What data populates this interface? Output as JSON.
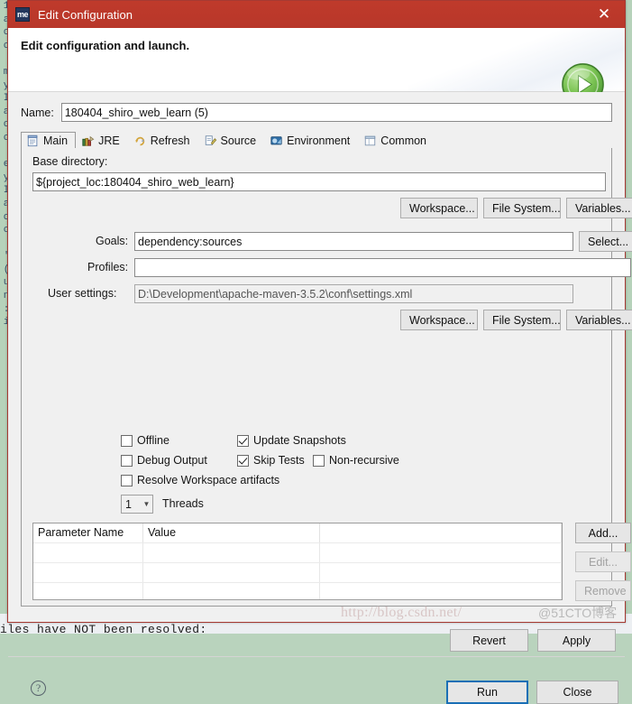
{
  "window": {
    "title": "Edit Configuration",
    "icon": "maven-me-icon",
    "close_label": "✕"
  },
  "header": {
    "title": "Edit configuration and launch.",
    "badge_icon": "run-play-icon"
  },
  "name_field": {
    "label": "Name:",
    "value": "180404_shiro_web_learn (5)",
    "placeholder": ""
  },
  "tabs": [
    {
      "label": "Main",
      "icon": "main-document-icon",
      "active": true
    },
    {
      "label": "JRE",
      "icon": "jre-books-icon",
      "active": false
    },
    {
      "label": "Refresh",
      "icon": "refresh-arrows-icon",
      "active": false
    },
    {
      "label": "Source",
      "icon": "source-pencil-icon",
      "active": false
    },
    {
      "label": "Environment",
      "icon": "environment-icon",
      "active": false
    },
    {
      "label": "Common",
      "icon": "common-window-icon",
      "active": false
    }
  ],
  "main_tab": {
    "base_directory": {
      "label": "Base directory:",
      "value": "${project_loc:180404_shiro_web_learn}",
      "buttons": [
        "Workspace...",
        "File System...",
        "Variables..."
      ]
    },
    "goals": {
      "label": "Goals:",
      "value": "dependency:sources",
      "select_button": "Select..."
    },
    "profiles": {
      "label": "Profiles:",
      "value": ""
    },
    "user_settings": {
      "label": "User settings:",
      "value": "D:\\Development\\apache-maven-3.5.2\\conf\\settings.xml",
      "buttons": [
        "Workspace...",
        "File System...",
        "Variables..."
      ]
    },
    "checkboxes": [
      {
        "label": "Offline",
        "checked": false
      },
      {
        "label": "Update Snapshots",
        "checked": true
      },
      {
        "label": "Debug Output",
        "checked": false
      },
      {
        "label": "Skip Tests",
        "checked": true
      },
      {
        "label": "Non-recursive",
        "checked": false
      },
      {
        "label": "Resolve Workspace artifacts",
        "checked": false
      }
    ],
    "threads": {
      "value": "1",
      "label": "Threads",
      "arrow_icon": "chevron-down-icon"
    },
    "parameters_table": {
      "columns": [
        "Parameter Name",
        "Value",
        ""
      ],
      "rows": [],
      "empty_row_count": 3
    },
    "table_buttons": [
      {
        "label": "Add...",
        "disabled": false
      },
      {
        "label": "Edit...",
        "disabled": true
      },
      {
        "label": "Remove",
        "disabled": true
      }
    ],
    "revert_button": "Revert",
    "apply_button": "Apply"
  },
  "footer": {
    "help_icon": "help-question-icon",
    "run_button": "Run",
    "close_button": "Close"
  },
  "background": {
    "watermark": "http://blog.csdn.net/",
    "watermark_overlay": "@51CTO博客",
    "bottom_text": "iles have NOT been resolved:",
    "left_column_chars": "1\na\no\nc\n\nm\ny\nI\na\no\nc\n\ne\ny\nI\na\no\nc\n\n'\n(\nu\nn\n:\ni"
  },
  "colors": {
    "titlebar": "#c0392b",
    "dialog_bg": "#f0f0f0",
    "accent_default_button": "#1a6fb5",
    "run_badge_green": "#6fbf4a",
    "editor_background": "#b6d2ba"
  }
}
